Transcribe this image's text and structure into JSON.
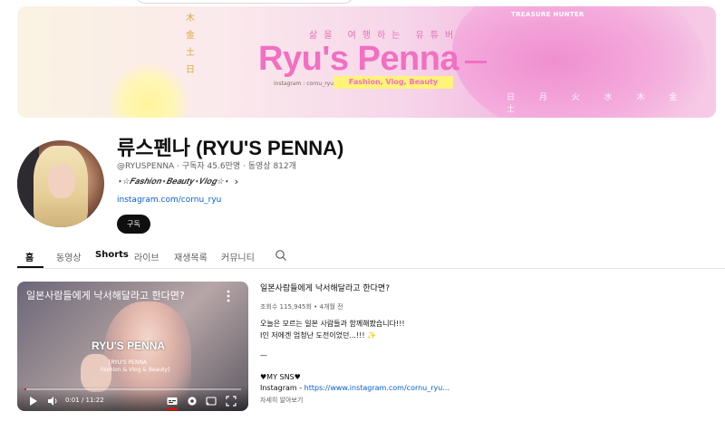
{
  "banner": {
    "vertical_chars": [
      "木",
      "金",
      "土",
      "日"
    ],
    "korean_title": "삶을 여행하는 유튜버",
    "logo": "Ryu's Penna",
    "instagram_small": "instagram : cornu_ryu",
    "tagline": "Fashion, Vlog, Beauty",
    "corner_label": "TREASURE HUNTER",
    "weekdays": "日 月 火 水 木 金 土"
  },
  "channel": {
    "name": "류스펜나 (RYU'S PENNA)",
    "handle": "@RYUSPENNA",
    "subscribers": "구독자 45.6만명",
    "video_count": "동영상 812개",
    "description": "⋆☆𝑭𝒂𝒔𝒉𝒊𝒐𝒏⋆𝑩𝒆𝒂𝒖𝒕𝒚⋆𝑽𝒍𝒐𝒈☆⋆",
    "more_chevron": "›",
    "link": "instagram.com/cornu_ryu",
    "subscribe_label": "구독",
    "accent_color": "#065fd4"
  },
  "tabs": [
    {
      "label": "홈",
      "active": true
    },
    {
      "label": "동영상",
      "active": false
    },
    {
      "label": "Shorts",
      "active": false
    },
    {
      "label": "라이브",
      "active": false
    },
    {
      "label": "재생목록",
      "active": false
    },
    {
      "label": "커뮤니티",
      "active": false
    }
  ],
  "search_icon": "search-icon",
  "featured": {
    "player_title": "일본사람들에게 낙서해달라고 한다면?",
    "overlay_name": "RYU'S PENNA",
    "overlay_sub1": "[RYU'S PENNA",
    "overlay_sub2": "Fashion & Vlog & Beauty]",
    "time": "0:01 / 11:22",
    "progress": 0.0015,
    "title": "일본사람들에게 낙서해달라고 한다면?",
    "meta": "조회수 115,945회 • 4개월 전",
    "desc_line1": "오늘은 모르는 일본 사람들과 함께해봤습니다!!!",
    "desc_line2": "I인 저에겐 엄청난 도전이었던...!!! ✨",
    "dash": "—",
    "sns": "♥MY SNS♥",
    "instagram_label": "Instagram - ",
    "instagram_url": "https://www.instagram.com/cornu_ryu...",
    "more": "자세히 알아보기"
  }
}
